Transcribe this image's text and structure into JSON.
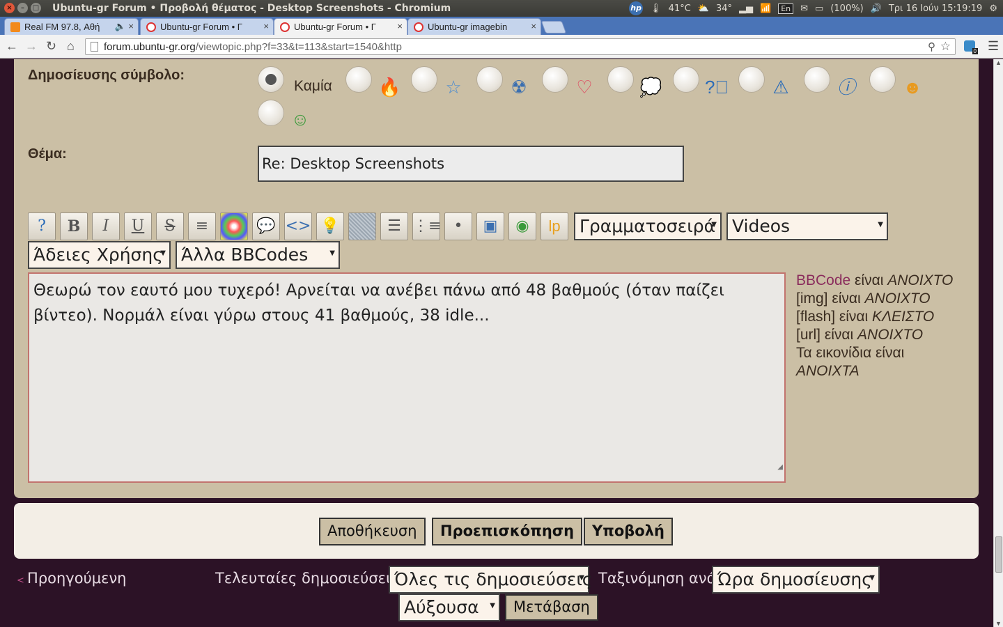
{
  "window": {
    "title": "Ubuntu-gr Forum • Προβολή θέματος - Desktop Screenshots - Chromium"
  },
  "tray": {
    "hp": "hp",
    "cpu_temp": "41°C",
    "weather": "34°",
    "keyboard": "En",
    "battery": "(100%)",
    "datetime": "Τρι 16 Ιούν 15:19:19"
  },
  "tabs": [
    {
      "label": "Real FM 97.8, Αθή",
      "icon": "rss-icon"
    },
    {
      "label": "Ubuntu-gr Forum • Γ",
      "icon": "ubuntu-icon"
    },
    {
      "label": "Ubuntu-gr Forum • Γ",
      "icon": "ubuntu-icon"
    },
    {
      "label": "Ubuntu-gr imagebin",
      "icon": "ubuntu-icon"
    }
  ],
  "address": {
    "domain": "forum.ubuntu-gr.org",
    "path": "/viewtopic.php?f=33&t=113&start=1540&http"
  },
  "extension_badge": "0",
  "form": {
    "icon_label": "Δημοσίευσης σύμβολο:",
    "none_label": "Καμία",
    "subject_label": "Θέμα:",
    "subject_value": "Re: Desktop Screenshots",
    "message": "Θεωρώ τον εαυτό μου τυχερό! Αρνείται να ανέβει πάνω από 48 βαθμούς (όταν παίζει βίντεο). Νορμάλ είναι γύρω στους 41 βαθμούς, 38  idle...",
    "font_select": "Γραμματοσειρά",
    "videos_select": "Videos",
    "license_select": "Άδειες Χρήσης",
    "other_bbcodes_select": "Άλλα BBCodes"
  },
  "toolbar_buttons": [
    "help-icon",
    "bold",
    "italic",
    "underline",
    "strike",
    "justify",
    "color",
    "quote",
    "code",
    "tip",
    "spoiler",
    "list",
    "numbered-list",
    "list-item",
    "image",
    "web-image",
    "lp"
  ],
  "bbinfo": {
    "bbcode_link": "BBCode",
    "bbcode_text": " είναι ",
    "bbcode_state": "ΑΝΟΙΧΤΟ",
    "img_text": "[img] είναι ",
    "img_state": "ΑΝΟΙΧΤΟ",
    "flash_text": "[flash] είναι ",
    "flash_state": "ΚΛΕΙΣΤΟ",
    "url_text": "[url] είναι ",
    "url_state": "ΑΝΟΙΧΤΟ",
    "smilies_text": "Τα εικονίδια είναι",
    "smilies_state": "ΑΝΟΙΧΤΑ"
  },
  "buttons": {
    "save": "Αποθήκευση",
    "preview": "Προεπισκόπηση",
    "submit": "Υποβολή"
  },
  "footer": {
    "previous": "Προηγούμενη",
    "recent_label": "Τελευταίες δημοσιεύσεις:",
    "recent_select": "Όλες τις δημοσιεύσεις",
    "sort_label": "Ταξινόμηση ανά",
    "sort_select": "Ώρα δημοσίευσης",
    "order_select": "Αύξουσα",
    "go": "Μετάβαση"
  },
  "colors": {
    "page_bg": "#2c1226",
    "panel_bg": "#cbbfa5",
    "link": "#8a2c5c",
    "tab_strip": "#4a74b7"
  }
}
